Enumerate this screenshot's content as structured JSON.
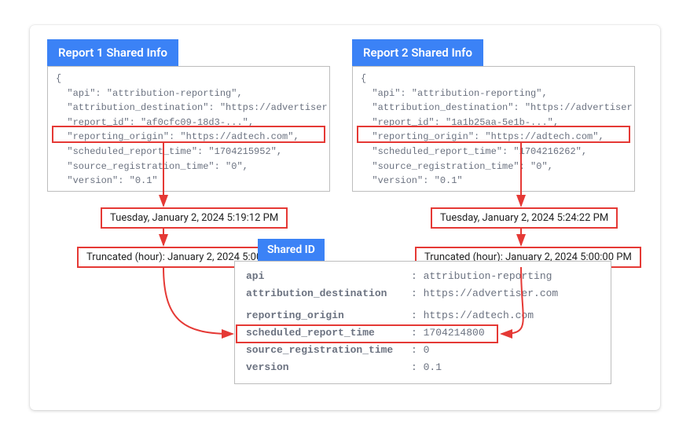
{
  "report1": {
    "title": "Report 1 Shared Info",
    "json": "{\n  \"api\": \"attribution-reporting\",\n  \"attribution_destination\": \"https://advertiser.com\",\n  \"report_id\": \"af0cfc09-18d3-...\",\n  \"reporting_origin\": \"https://adtech.com\",\n  \"scheduled_report_time\": \"1704215952\",\n  \"source_registration_time\": \"0\",\n  \"version\": \"0.1\"\n}",
    "readable_time": "Tuesday, January 2, 2024 5:19:12 PM",
    "truncated": "Truncated (hour): January 2, 2024 5:00:00 PM"
  },
  "report2": {
    "title": "Report 2 Shared Info",
    "json": "{\n  \"api\": \"attribution-reporting\",\n  \"attribution_destination\": \"https://advertiser.com\",\n  \"report_id\": \"1a1b25aa-5e1b-...\",\n  \"reporting_origin\": \"https://adtech.com\",\n  \"scheduled_report_time\": \"1704216262\",\n  \"source_registration_time\": \"0\",\n  \"version\": \"0.1\"\n}",
    "readable_time": "Tuesday, January 2, 2024 5:24:22 PM",
    "truncated": "Truncated (hour): January 2, 2024 5:00:00 PM"
  },
  "shared": {
    "title": "Shared ID",
    "rows": [
      {
        "k": "api",
        "v": "attribution-reporting",
        "bold": true
      },
      {
        "k": "attribution_destination",
        "v": "https://advertiser.com",
        "bold": true
      },
      {
        "k": "reporting_origin",
        "v": "https://adtech.com",
        "bold": true
      },
      {
        "k": "scheduled_report_time",
        "v": "1704214800",
        "bold": true
      },
      {
        "k": "source_registration_time",
        "v": "0",
        "bold": true
      },
      {
        "k": "version",
        "v": "0.1",
        "bold": true
      }
    ]
  },
  "colors": {
    "blue": "#3b82f6",
    "red": "#e53935",
    "gray_border": "#bdbdbd",
    "code_text": "#6b7280"
  }
}
